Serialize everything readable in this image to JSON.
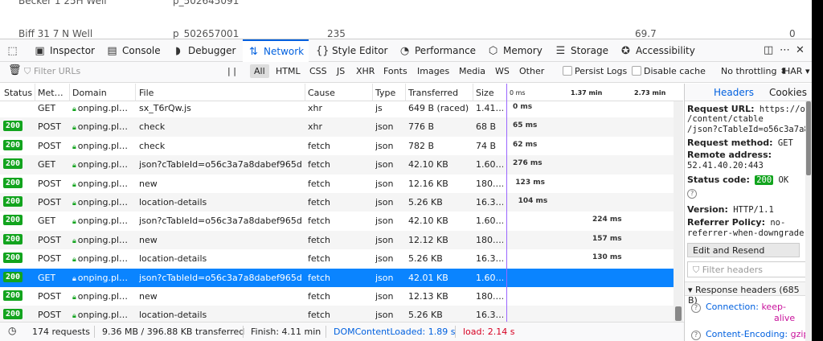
{
  "page_rows": [
    {
      "name": "Becker 1 25H Well",
      "id": "p_502645091",
      "v1": "",
      "v2": "",
      "v3": ""
    },
    {
      "name": "Biff 31 7 N Well",
      "id": "p_502657001",
      "v1": "235",
      "v2": "69.7",
      "v3": "0"
    }
  ],
  "toolbar": {
    "tabs": [
      {
        "label": "Inspector",
        "icon": "inspector-icon"
      },
      {
        "label": "Console",
        "icon": "console-icon"
      },
      {
        "label": "Debugger",
        "icon": "debugger-icon"
      },
      {
        "label": "Network",
        "icon": "network-icon"
      },
      {
        "label": "Style Editor",
        "icon": "style-editor-icon"
      },
      {
        "label": "Performance",
        "icon": "performance-icon"
      },
      {
        "label": "Memory",
        "icon": "memory-icon"
      },
      {
        "label": "Storage",
        "icon": "storage-icon"
      },
      {
        "label": "Accessibility",
        "icon": "accessibility-icon"
      }
    ],
    "pick_icon": "pick-element-icon",
    "dock_icon": "dock-icon",
    "more_icon": "more-icon",
    "close_icon": "close-icon"
  },
  "filterbar": {
    "trash_icon": "trash-icon",
    "placeholder": "Filter URLs",
    "pause": "| |",
    "types": [
      "All",
      "HTML",
      "CSS",
      "JS",
      "XHR",
      "Fonts",
      "Images",
      "Media",
      "WS",
      "Other"
    ],
    "persist_logs": "Persist Logs",
    "disable_cache": "Disable cache",
    "throttling": "No throttling",
    "har": "HAR"
  },
  "table": {
    "headers": [
      "Status",
      "Met…",
      "Domain",
      "File",
      "Cause",
      "Type",
      "Transferred",
      "Size"
    ],
    "waterfall_ticks": [
      "0 ms",
      "1.37 min",
      "2.73 min"
    ],
    "rows": [
      {
        "status": "",
        "method": "GET",
        "domain": "onping.pl…",
        "file": "sx_T6rQw.js",
        "cause": "xhr",
        "type": "js",
        "transferred": "649 B (raced)",
        "size": "1.41…",
        "time": "0 ms",
        "timepos": 0
      },
      {
        "status": "200",
        "method": "POST",
        "domain": "onping.pl…",
        "file": "check",
        "cause": "xhr",
        "type": "json",
        "transferred": "776 B",
        "size": "68 B",
        "time": "65 ms",
        "timepos": 0
      },
      {
        "status": "200",
        "method": "POST",
        "domain": "onping.pl…",
        "file": "check",
        "cause": "fetch",
        "type": "json",
        "transferred": "782 B",
        "size": "74 B",
        "time": "62 ms",
        "timepos": 0
      },
      {
        "status": "200",
        "method": "GET",
        "domain": "onping.pl…",
        "file": "json?cTableId=o56c3a7a8dabef965d…",
        "cause": "fetch",
        "type": "json",
        "transferred": "42.10 KB",
        "size": "1.60…",
        "time": "276 ms",
        "timepos": 0
      },
      {
        "status": "200",
        "method": "POST",
        "domain": "onping.pl…",
        "file": "new",
        "cause": "fetch",
        "type": "json",
        "transferred": "12.16 KB",
        "size": "180.…",
        "time": "123 ms",
        "timepos": 0.02
      },
      {
        "status": "200",
        "method": "POST",
        "domain": "onping.pl…",
        "file": "location-details",
        "cause": "fetch",
        "type": "json",
        "transferred": "5.26 KB",
        "size": "16.3…",
        "time": "104 ms",
        "timepos": 0.04
      },
      {
        "status": "200",
        "method": "GET",
        "domain": "onping.pl…",
        "file": "json?cTableId=o56c3a7a8dabef965d…",
        "cause": "fetch",
        "type": "json",
        "transferred": "42.10 KB",
        "size": "1.60…",
        "time": "224 ms",
        "timepos": 0.6
      },
      {
        "status": "200",
        "method": "POST",
        "domain": "onping.pl…",
        "file": "new",
        "cause": "fetch",
        "type": "json",
        "transferred": "12.12 KB",
        "size": "180.…",
        "time": "157 ms",
        "timepos": 0.6
      },
      {
        "status": "200",
        "method": "POST",
        "domain": "onping.pl…",
        "file": "location-details",
        "cause": "fetch",
        "type": "json",
        "transferred": "5.26 KB",
        "size": "16.3…",
        "time": "130 ms",
        "timepos": 0.6
      },
      {
        "status": "200",
        "method": "GET",
        "domain": "onping.pl…",
        "file": "json?cTableId=o56c3a7a8dabef965d…",
        "cause": "fetch",
        "type": "json",
        "transferred": "42.01 KB",
        "size": "1.60…",
        "time": "",
        "timepos": 0.9,
        "selected": true
      },
      {
        "status": "200",
        "method": "POST",
        "domain": "onping.pl…",
        "file": "new",
        "cause": "fetch",
        "type": "json",
        "transferred": "12.13 KB",
        "size": "180.…",
        "time": "",
        "timepos": 0.9
      },
      {
        "status": "200",
        "method": "POST",
        "domain": "onping.pl…",
        "file": "location-details",
        "cause": "fetch",
        "type": "json",
        "transferred": "5.26 KB",
        "size": "16.3…",
        "time": "",
        "timepos": 0.9
      }
    ]
  },
  "statusbar": {
    "clock_icon": "clock-icon",
    "requests": "174 requests",
    "transferred": "9.36 MB / 396.88 KB transferred",
    "finish": "Finish: 4.11 min",
    "dcl": "DOMContentLoaded: 1.89 s",
    "load": "load: 2.14 s"
  },
  "sidepanel": {
    "tabs": [
      "Headers",
      "Cookies"
    ],
    "request_url_label": "Request URL:",
    "request_url": [
      "https://onp",
      "/content/ctable",
      "/json?cTableId=o56c3a7a8"
    ],
    "method_label": "Request method:",
    "method": "GET",
    "remote_label": "Remote address:",
    "remote": "52.41.40.20:443",
    "status_label": "Status code:",
    "status": "200",
    "status_text": "OK",
    "version_label": "Version:",
    "version": "HTTP/1.1",
    "referrer_label": "Referrer Policy:",
    "referrer": [
      "no-",
      "referrer-when-downgrade"
    ],
    "edit_resend": "Edit and Resend",
    "filter_headers": "Filter headers",
    "response_headers": "Response headers (685 B)",
    "headers": [
      {
        "name": "Connection:",
        "value": "keep-",
        "value2": "alive"
      },
      {
        "name": "Content-Encoding:",
        "value": "gzip",
        "value2": ""
      }
    ]
  },
  "colors": {
    "accent": "#0060df",
    "selected": "#0a84ff",
    "ok": "#12a41e",
    "purple": "#9a66ff",
    "value": "#c8119b"
  }
}
